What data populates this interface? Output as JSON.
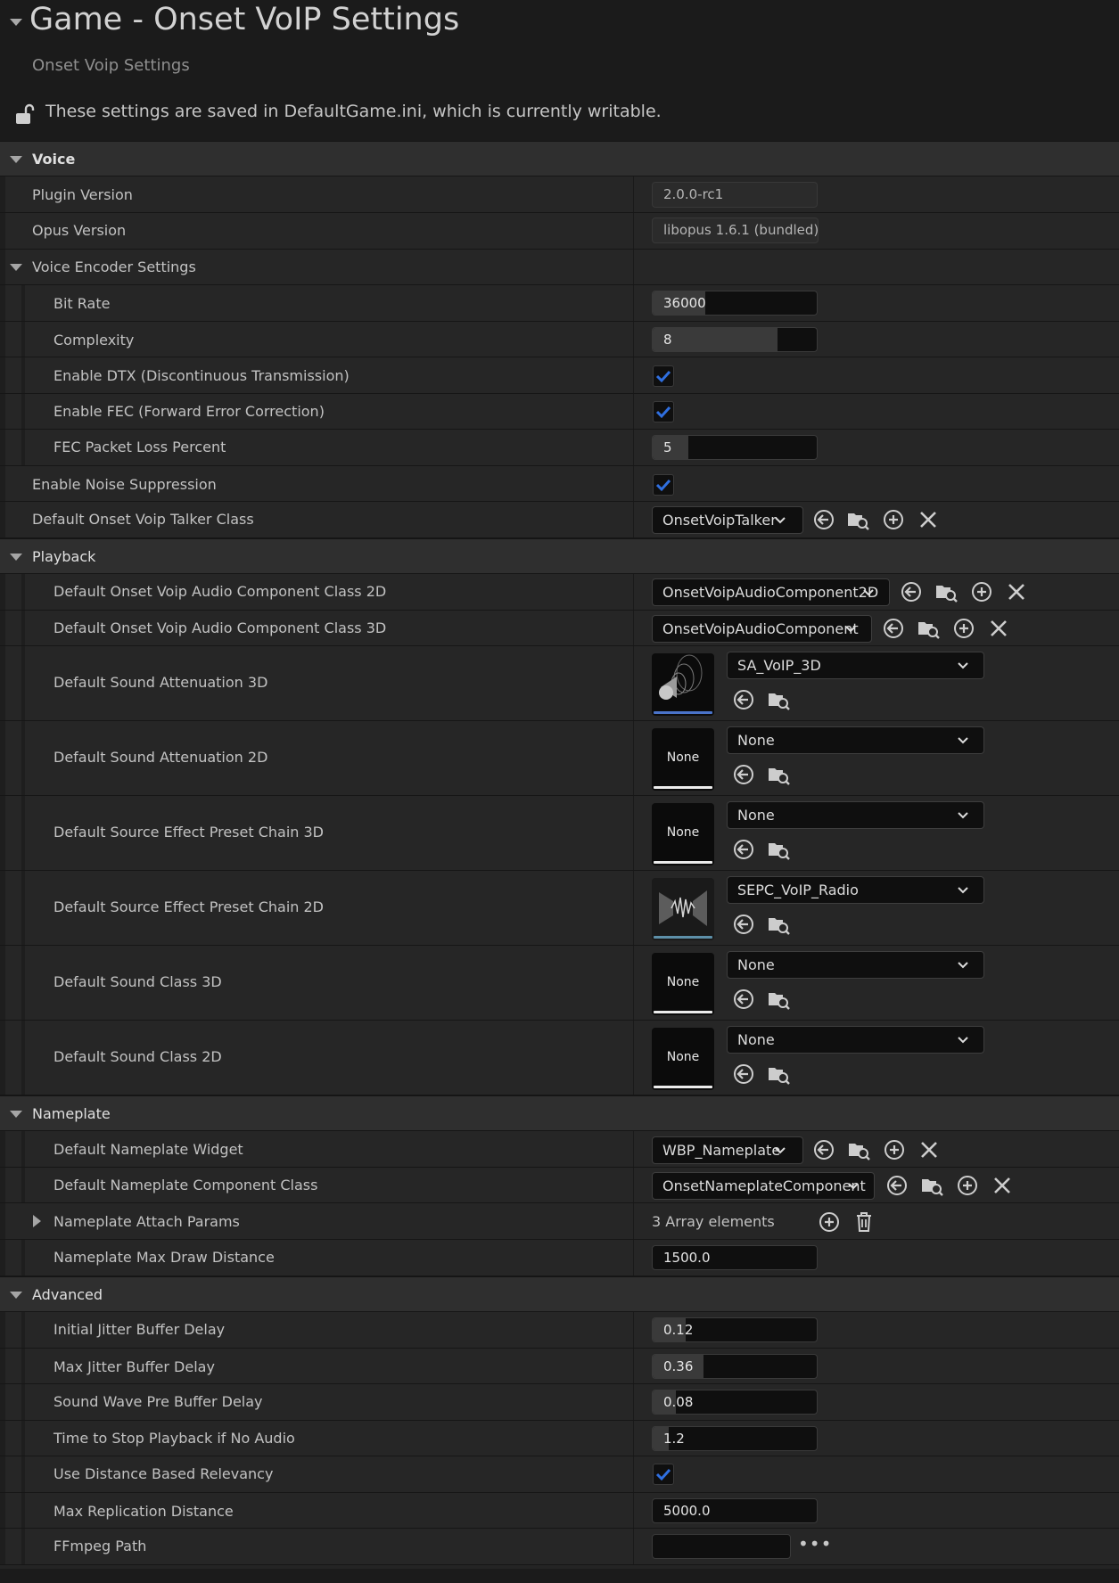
{
  "header": {
    "title": "Game - Onset VoIP Settings",
    "subtitle": "Onset Voip Settings",
    "notice": "These settings are saved in DefaultGame.ini, which is currently writable."
  },
  "icons": {
    "lock": "unlocked-lock-icon",
    "use": "use-selected-arrow-icon",
    "browse": "browse-folder-icon",
    "add": "add-plus-icon",
    "clear": "clear-x-icon",
    "delete": "trash-icon",
    "more": "ellipsis-icon"
  },
  "colors": {
    "check": "#2f6fe0",
    "accent_blue": "#4a73c9"
  },
  "voice": {
    "header": "Voice",
    "plugin_version": {
      "label": "Plugin Version",
      "value": "2.0.0-rc1"
    },
    "opus_version": {
      "label": "Opus Version",
      "value": "libopus 1.6.1 (bundled)"
    },
    "encoder": {
      "header": "Voice Encoder Settings",
      "bit_rate": {
        "label": "Bit Rate",
        "value": "36000",
        "fill": 0.32
      },
      "complexity": {
        "label": "Complexity",
        "value": "8",
        "fill": 0.76
      },
      "dtx": {
        "label": "Enable DTX (Discontinuous Transmission)",
        "checked": true
      },
      "fec": {
        "label": "Enable FEC (Forward Error Correction)",
        "checked": true
      },
      "fec_loss": {
        "label": "FEC Packet Loss Percent",
        "value": "5",
        "fill": 0.22
      }
    },
    "noise_suppression": {
      "label": "Enable Noise Suppression",
      "checked": true
    },
    "talker_class": {
      "label": "Default Onset Voip Talker Class",
      "value": "OnsetVoipTalker"
    }
  },
  "playback": {
    "header": "Playback",
    "audio_2d": {
      "label": "Default Onset Voip Audio Component Class 2D",
      "value": "OnsetVoipAudioComponent2D"
    },
    "audio_3d": {
      "label": "Default Onset Voip Audio Component Class 3D",
      "value": "OnsetVoipAudioComponent"
    },
    "atten_3d": {
      "label": "Default Sound Attenuation 3D",
      "value": "SA_VoIP_3D"
    },
    "atten_2d": {
      "label": "Default Sound Attenuation 2D",
      "value": "None",
      "thumb": "None"
    },
    "chain_3d": {
      "label": "Default Source Effect Preset Chain 3D",
      "value": "None",
      "thumb": "None"
    },
    "chain_2d": {
      "label": "Default Source Effect Preset Chain 2D",
      "value": "SEPC_VoIP_Radio"
    },
    "class_3d": {
      "label": "Default Sound Class 3D",
      "value": "None",
      "thumb": "None"
    },
    "class_2d": {
      "label": "Default Sound Class 2D",
      "value": "None",
      "thumb": "None"
    }
  },
  "nameplate": {
    "header": "Nameplate",
    "widget": {
      "label": "Default Nameplate Widget",
      "value": "WBP_Nameplate"
    },
    "component": {
      "label": "Default Nameplate Component Class",
      "value": "OnsetNameplateComponent"
    },
    "attach": {
      "label": "Nameplate Attach Params",
      "value": "3 Array elements"
    },
    "max_draw": {
      "label": "Nameplate Max Draw Distance",
      "value": "1500.0"
    }
  },
  "advanced": {
    "header": "Advanced",
    "initial_jitter": {
      "label": "Initial Jitter Buffer Delay",
      "value": "0.12",
      "fill": 0.2
    },
    "max_jitter": {
      "label": "Max Jitter Buffer Delay",
      "value": "0.36",
      "fill": 0.31
    },
    "prebuffer": {
      "label": "Sound Wave Pre Buffer Delay",
      "value": "0.08",
      "fill": 0.14
    },
    "stop_playback": {
      "label": "Time to Stop Playback if No Audio",
      "value": "1.2",
      "fill": 0.1
    },
    "distance_relevancy": {
      "label": "Use Distance Based Relevancy",
      "checked": true
    },
    "max_replication": {
      "label": "Max Replication Distance",
      "value": "5000.0"
    },
    "ffmpeg": {
      "label": "FFmpeg Path",
      "value": ""
    }
  }
}
